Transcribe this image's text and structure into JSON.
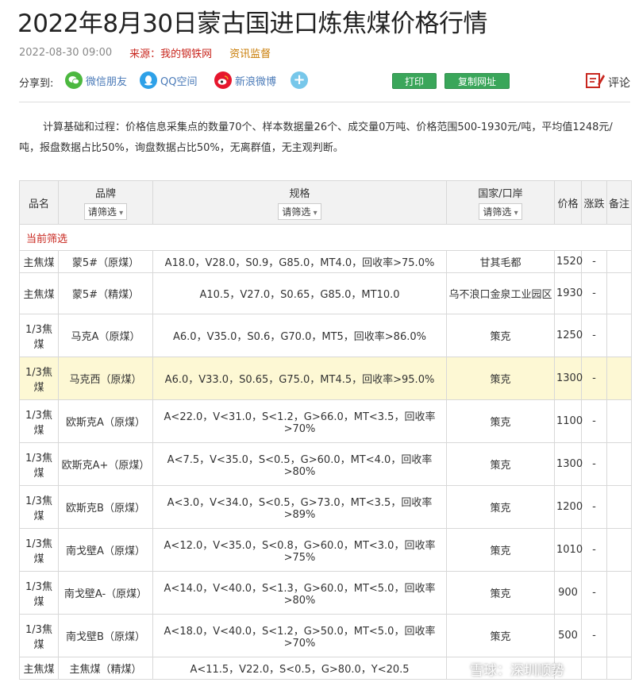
{
  "article": {
    "title": "2022年8月30日蒙古国进口炼焦煤价格行情",
    "datetime": "2022-08-30 09:00",
    "source": "来源：我的钢铁网",
    "audit": "资讯监督"
  },
  "share": {
    "label": "分享到:",
    "wechat": "微信朋友",
    "qq": "QQ空间",
    "weibo": "新浪微博",
    "print": "打印",
    "copy": "复制网址",
    "comment": "评论"
  },
  "description": "计算基础和过程：价格信息采集点的数量70个、样本数据量26个、成交量0万吨、价格范围500-1930元/吨，平均值1248元/吨，报盘数据占比50%，询盘数据占比50%，无离群值，无主观判断。",
  "table": {
    "headers": {
      "name": "品名",
      "brand": "品牌",
      "spec": "规格",
      "origin": "国家/口岸",
      "price": "价格",
      "change": "涨跌",
      "note": "备注",
      "filter": "请筛选"
    },
    "current_filter": "当前筛选",
    "rows": [
      {
        "name": "主焦煤",
        "brand": "蒙5#（原煤）",
        "spec": "A18.0，V28.0，S0.9，G85.0，MT4.0，回收率>75.0%",
        "origin": "甘其毛都",
        "price": "1520",
        "change": "-",
        "note": ""
      },
      {
        "name": "主焦煤",
        "brand": "蒙5#（精煤）",
        "spec": "A10.5，V27.0，S0.65，G85.0，MT10.0",
        "origin": "乌不浪口金泉工业园区",
        "price": "1930",
        "change": "-",
        "note": ""
      },
      {
        "name": "1/3焦煤",
        "brand": "马克A（原煤）",
        "spec": "A6.0，V35.0，S0.6，G70.0，MT5，回收率>86.0%",
        "origin": "策克",
        "price": "1250",
        "change": "-",
        "note": ""
      },
      {
        "name": "1/3焦煤",
        "brand": "马克西（原煤）",
        "spec": "A6.0，V33.0，S0.65，G75.0，MT4.5，回收率>95.0%",
        "origin": "策克",
        "price": "1300",
        "change": "-",
        "note": ""
      },
      {
        "name": "1/3焦煤",
        "brand": "欧斯克A（原煤）",
        "spec": "A<22.0，V<31.0，S<1.2，G>66.0，MT<3.5，回收率>70%",
        "origin": "策克",
        "price": "1100",
        "change": "-",
        "note": ""
      },
      {
        "name": "1/3焦煤",
        "brand": "欧斯克A+（原煤）",
        "spec": "A<7.5，V<35.0，S<0.5，G>60.0，MT<4.0，回收率>80%",
        "origin": "策克",
        "price": "1300",
        "change": "-",
        "note": ""
      },
      {
        "name": "1/3焦煤",
        "brand": "欧斯克B（原煤）",
        "spec": "A<3.0，V<34.0，S<0.5，G>73.0，MT<3.5，回收率>89%",
        "origin": "策克",
        "price": "1200",
        "change": "-",
        "note": ""
      },
      {
        "name": "1/3焦煤",
        "brand": "南戈壁A（原煤）",
        "spec": "A<12.0，V<35.0，S<0.8，G>60.0，MT<3.0，回收率>75%",
        "origin": "策克",
        "price": "1010",
        "change": "-",
        "note": ""
      },
      {
        "name": "1/3焦煤",
        "brand": "南戈壁A-（原煤）",
        "spec": "A<14.0，V<40.0，S<1.3，G>60.0，MT<5.0，回收率>80%",
        "origin": "策克",
        "price": "900",
        "change": "-",
        "note": ""
      },
      {
        "name": "1/3焦煤",
        "brand": "南戈壁B（原煤）",
        "spec": "A<18.0，V<40.0，S<1.2，G>50.0，MT<5.0，回收率>70%",
        "origin": "策克",
        "price": "500",
        "change": "-",
        "note": ""
      },
      {
        "name": "主焦煤",
        "brand": "主焦煤（精煤）",
        "spec": "A<11.5，V22.0，S<0.5，G>80.0，Y<20.5",
        "origin": "",
        "price": "",
        "change": "",
        "note": ""
      }
    ]
  },
  "footer": {
    "watermark": "雪球：深圳顺势"
  },
  "colors": {
    "accent_red": "#c8261e",
    "button_green": "#3aa65a",
    "highlight_row": "#fdf8d4"
  }
}
